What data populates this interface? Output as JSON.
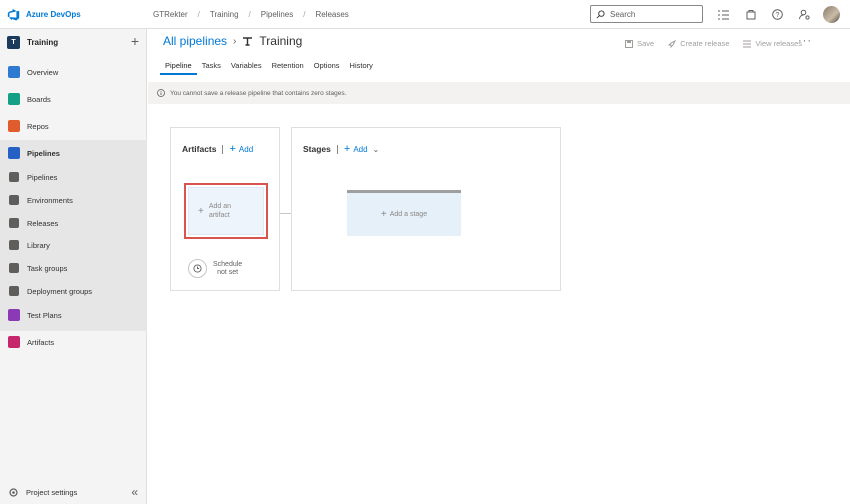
{
  "topbar": {
    "brand": "Azure DevOps",
    "breadcrumbs": [
      "GTRekter",
      "Training",
      "Pipelines",
      "Releases"
    ],
    "search_placeholder": "Search"
  },
  "sidebar": {
    "project_initial": "T",
    "project_name": "Training",
    "items": [
      {
        "label": "Overview",
        "color": "#2e7ad1"
      },
      {
        "label": "Boards",
        "color": "#14a085"
      },
      {
        "label": "Repos",
        "color": "#e05c2c"
      },
      {
        "label": "Pipelines",
        "color": "#2560c4"
      },
      {
        "label": "Pipelines",
        "color": "#605e5c"
      },
      {
        "label": "Environments",
        "color": "#605e5c"
      },
      {
        "label": "Releases",
        "color": "#605e5c"
      },
      {
        "label": "Library",
        "color": "#605e5c"
      },
      {
        "label": "Task groups",
        "color": "#605e5c"
      },
      {
        "label": "Deployment groups",
        "color": "#605e5c"
      },
      {
        "label": "Test Plans",
        "color": "#8a3ab5"
      },
      {
        "label": "Artifacts",
        "color": "#c6276b"
      }
    ],
    "settings_label": "Project settings"
  },
  "main": {
    "all_pipelines": "All pipelines",
    "pipeline_name": "Training",
    "actions": {
      "save": "Save",
      "create_release": "Create release",
      "view_releases": "View releases"
    },
    "tabs": [
      "Pipeline",
      "Tasks",
      "Variables",
      "Retention",
      "Options",
      "History"
    ],
    "notice": "You cannot save a release pipeline that contains zero stages.",
    "artifacts": {
      "title": "Artifacts",
      "add_label": "Add",
      "add_artifact_line1": "Add an",
      "add_artifact_line2": "artifact",
      "schedule_line1": "Schedule",
      "schedule_line2": "not set"
    },
    "stages": {
      "title": "Stages",
      "add_label": "Add",
      "add_stage": "Add a stage"
    }
  }
}
